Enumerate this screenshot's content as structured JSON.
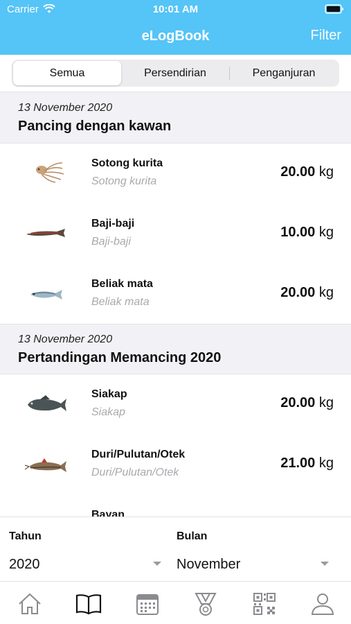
{
  "status_bar": {
    "carrier": "Carrier",
    "time": "10:01 AM"
  },
  "nav": {
    "title": "eLogBook",
    "filter_label": "Filter"
  },
  "segments": [
    "Semua",
    "Persendirian",
    "Penganjuran"
  ],
  "sections": [
    {
      "date": "13 November 2020",
      "title": "Pancing dengan kawan",
      "items": [
        {
          "name": "Sotong kurita",
          "sub": "Sotong kurita",
          "weight": "20.00",
          "unit": "kg",
          "icon": "octopus-icon"
        },
        {
          "name": "Baji-baji",
          "sub": "Baji-baji",
          "weight": "10.00",
          "unit": "kg",
          "icon": "flathead-fish-icon"
        },
        {
          "name": "Beliak mata",
          "sub": "Beliak mata",
          "weight": "20.00",
          "unit": "kg",
          "icon": "herring-fish-icon"
        }
      ]
    },
    {
      "date": "13 November 2020",
      "title": "Pertandingan Memancing 2020",
      "items": [
        {
          "name": "Siakap",
          "sub": "Siakap",
          "weight": "20.00",
          "unit": "kg",
          "icon": "barramundi-fish-icon"
        },
        {
          "name": "Duri/Pulutan/Otek",
          "sub": "Duri/Pulutan/Otek",
          "weight": "21.00",
          "unit": "kg",
          "icon": "catfish-icon"
        },
        {
          "name": "Bayan",
          "sub": "",
          "weight": "",
          "unit": "",
          "icon": ""
        }
      ]
    }
  ],
  "filter": {
    "year_label": "Tahun",
    "year_value": "2020",
    "month_label": "Bulan",
    "month_value": "November"
  },
  "tabs": [
    "home-icon",
    "book-icon",
    "calendar-icon",
    "medal-icon",
    "qr-code-icon",
    "profile-icon"
  ],
  "colors": {
    "accent": "#55c4f6",
    "section_bg": "#f2f2f6",
    "subtitle": "#a9a9ae"
  }
}
